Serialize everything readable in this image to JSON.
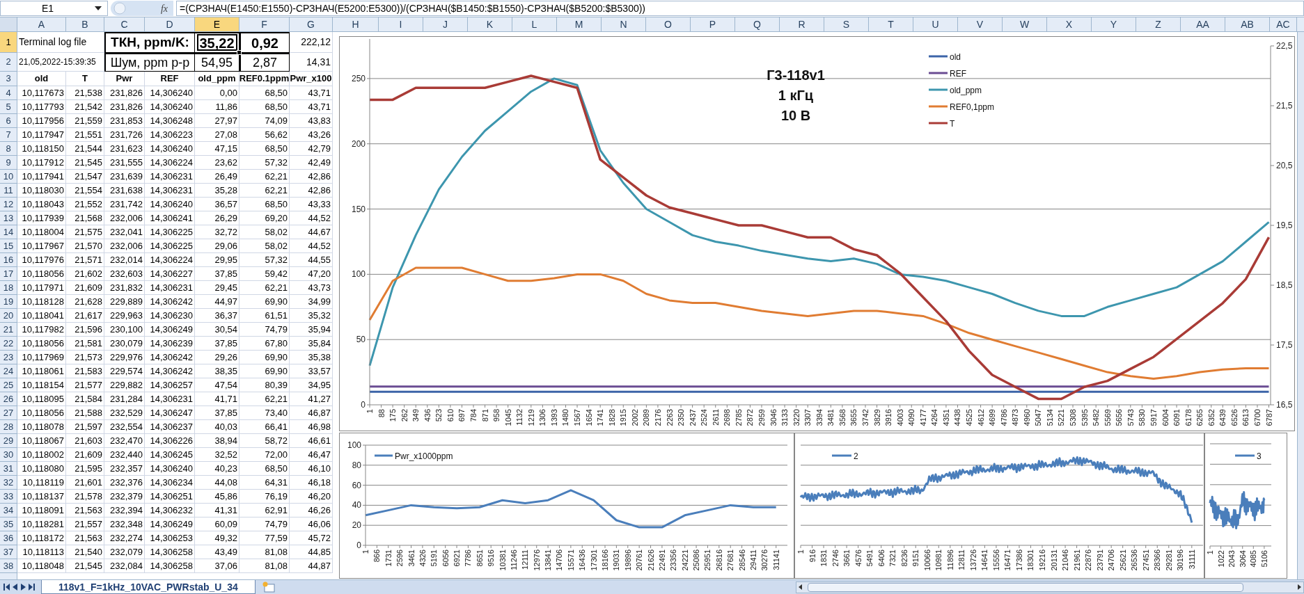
{
  "formula_bar": {
    "name_box": "E1",
    "function_label": "fx",
    "formula": "=(СРЗНАЧ(E1450:E1550)-СРЗНАЧ(E5200:E5300))/(СРЗНАЧ($B1450:$B1550)-СРЗНАЧ($B5200:$B5300))"
  },
  "columns": [
    {
      "label": "A",
      "selected": false
    },
    {
      "label": "B",
      "selected": false
    },
    {
      "label": "C",
      "selected": false
    },
    {
      "label": "D",
      "selected": false
    },
    {
      "label": "E",
      "selected": true
    },
    {
      "label": "F",
      "selected": false
    },
    {
      "label": "G",
      "selected": false
    },
    {
      "label": "H",
      "selected": false
    },
    {
      "label": "I",
      "selected": false
    },
    {
      "label": "J",
      "selected": false
    },
    {
      "label": "K",
      "selected": false
    },
    {
      "label": "L",
      "selected": false
    },
    {
      "label": "M",
      "selected": false
    },
    {
      "label": "N",
      "selected": false
    },
    {
      "label": "O",
      "selected": false
    },
    {
      "label": "P",
      "selected": false
    },
    {
      "label": "Q",
      "selected": false
    },
    {
      "label": "R",
      "selected": false
    },
    {
      "label": "S",
      "selected": false
    },
    {
      "label": "T",
      "selected": false
    },
    {
      "label": "U",
      "selected": false
    },
    {
      "label": "V",
      "selected": false
    },
    {
      "label": "W",
      "selected": false
    },
    {
      "label": "X",
      "selected": false
    },
    {
      "label": "Y",
      "selected": false
    },
    {
      "label": "Z",
      "selected": false
    },
    {
      "label": "AA",
      "selected": false
    },
    {
      "label": "AB",
      "selected": false
    },
    {
      "label": "AC",
      "selected": false
    }
  ],
  "rows": [
    {
      "num": "1",
      "kind": "title",
      "selected": true,
      "cells": [
        "Terminal log file",
        "ТКН, ppm/K:",
        "35,22",
        "0,92",
        "222,12"
      ]
    },
    {
      "num": "2",
      "kind": "summary",
      "selected": false,
      "cells": [
        "21,05,2022-15:39:35",
        "Шум, ppm p-p",
        "54,95",
        "2,87",
        "14,31"
      ]
    },
    {
      "num": "3",
      "kind": "header",
      "selected": false,
      "cells": [
        "old",
        "T",
        "Pwr",
        "REF",
        "old_ppm",
        "REF0.1ppm",
        "Pwr_x100"
      ]
    },
    {
      "num": "4",
      "kind": "data",
      "selected": false,
      "cells": [
        "10,117673",
        "21,538",
        "231,826",
        "14,306240",
        "0,00",
        "68,50",
        "43,71"
      ]
    },
    {
      "num": "5",
      "kind": "data",
      "selected": false,
      "cells": [
        "10,117793",
        "21,542",
        "231,826",
        "14,306240",
        "11,86",
        "68,50",
        "43,71"
      ]
    },
    {
      "num": "6",
      "kind": "data",
      "selected": false,
      "cells": [
        "10,117956",
        "21,559",
        "231,853",
        "14,306248",
        "27,97",
        "74,09",
        "43,83"
      ]
    },
    {
      "num": "7",
      "kind": "data",
      "selected": false,
      "cells": [
        "10,117947",
        "21,551",
        "231,726",
        "14,306223",
        "27,08",
        "56,62",
        "43,26"
      ]
    },
    {
      "num": "8",
      "kind": "data",
      "selected": false,
      "cells": [
        "10,118150",
        "21,544",
        "231,623",
        "14,306240",
        "47,15",
        "68,50",
        "42,79"
      ]
    },
    {
      "num": "9",
      "kind": "data",
      "selected": false,
      "cells": [
        "10,117912",
        "21,545",
        "231,555",
        "14,306224",
        "23,62",
        "57,32",
        "42,49"
      ]
    },
    {
      "num": "10",
      "kind": "data",
      "selected": false,
      "cells": [
        "10,117941",
        "21,547",
        "231,639",
        "14,306231",
        "26,49",
        "62,21",
        "42,86"
      ]
    },
    {
      "num": "11",
      "kind": "data",
      "selected": false,
      "cells": [
        "10,118030",
        "21,554",
        "231,638",
        "14,306231",
        "35,28",
        "62,21",
        "42,86"
      ]
    },
    {
      "num": "12",
      "kind": "data",
      "selected": false,
      "cells": [
        "10,118043",
        "21,552",
        "231,742",
        "14,306240",
        "36,57",
        "68,50",
        "43,33"
      ]
    },
    {
      "num": "13",
      "kind": "data",
      "selected": false,
      "cells": [
        "10,117939",
        "21,568",
        "232,006",
        "14,306241",
        "26,29",
        "69,20",
        "44,52"
      ]
    },
    {
      "num": "14",
      "kind": "data",
      "selected": false,
      "cells": [
        "10,118004",
        "21,575",
        "232,041",
        "14,306225",
        "32,72",
        "58,02",
        "44,67"
      ]
    },
    {
      "num": "15",
      "kind": "data",
      "selected": false,
      "cells": [
        "10,117967",
        "21,570",
        "232,006",
        "14,306225",
        "29,06",
        "58,02",
        "44,52"
      ]
    },
    {
      "num": "16",
      "kind": "data",
      "selected": false,
      "cells": [
        "10,117976",
        "21,571",
        "232,014",
        "14,306224",
        "29,95",
        "57,32",
        "44,55"
      ]
    },
    {
      "num": "17",
      "kind": "data",
      "selected": false,
      "cells": [
        "10,118056",
        "21,602",
        "232,603",
        "14,306227",
        "37,85",
        "59,42",
        "47,20"
      ]
    },
    {
      "num": "18",
      "kind": "data",
      "selected": false,
      "cells": [
        "10,117971",
        "21,609",
        "231,832",
        "14,306231",
        "29,45",
        "62,21",
        "43,73"
      ]
    },
    {
      "num": "19",
      "kind": "data",
      "selected": false,
      "cells": [
        "10,118128",
        "21,628",
        "229,889",
        "14,306242",
        "44,97",
        "69,90",
        "34,99"
      ]
    },
    {
      "num": "20",
      "kind": "data",
      "selected": false,
      "cells": [
        "10,118041",
        "21,617",
        "229,963",
        "14,306230",
        "36,37",
        "61,51",
        "35,32"
      ]
    },
    {
      "num": "21",
      "kind": "data",
      "selected": false,
      "cells": [
        "10,117982",
        "21,596",
        "230,100",
        "14,306249",
        "30,54",
        "74,79",
        "35,94"
      ]
    },
    {
      "num": "22",
      "kind": "data",
      "selected": false,
      "cells": [
        "10,118056",
        "21,581",
        "230,079",
        "14,306239",
        "37,85",
        "67,80",
        "35,84"
      ]
    },
    {
      "num": "23",
      "kind": "data",
      "selected": false,
      "cells": [
        "10,117969",
        "21,573",
        "229,976",
        "14,306242",
        "29,26",
        "69,90",
        "35,38"
      ]
    },
    {
      "num": "24",
      "kind": "data",
      "selected": false,
      "cells": [
        "10,118061",
        "21,583",
        "229,574",
        "14,306242",
        "38,35",
        "69,90",
        "33,57"
      ]
    },
    {
      "num": "25",
      "kind": "data",
      "selected": false,
      "cells": [
        "10,118154",
        "21,577",
        "229,882",
        "14,306257",
        "47,54",
        "80,39",
        "34,95"
      ]
    },
    {
      "num": "26",
      "kind": "data",
      "selected": false,
      "cells": [
        "10,118095",
        "21,584",
        "231,284",
        "14,306231",
        "41,71",
        "62,21",
        "41,27"
      ]
    },
    {
      "num": "27",
      "kind": "data",
      "selected": false,
      "cells": [
        "10,118056",
        "21,588",
        "232,529",
        "14,306247",
        "37,85",
        "73,40",
        "46,87"
      ]
    },
    {
      "num": "28",
      "kind": "data",
      "selected": false,
      "cells": [
        "10,118078",
        "21,597",
        "232,554",
        "14,306237",
        "40,03",
        "66,41",
        "46,98"
      ]
    },
    {
      "num": "29",
      "kind": "data",
      "selected": false,
      "cells": [
        "10,118067",
        "21,603",
        "232,470",
        "14,306226",
        "38,94",
        "58,72",
        "46,61"
      ]
    },
    {
      "num": "30",
      "kind": "data",
      "selected": false,
      "cells": [
        "10,118002",
        "21,609",
        "232,440",
        "14,306245",
        "32,52",
        "72,00",
        "46,47"
      ]
    },
    {
      "num": "31",
      "kind": "data",
      "selected": false,
      "cells": [
        "10,118080",
        "21,595",
        "232,357",
        "14,306240",
        "40,23",
        "68,50",
        "46,10"
      ]
    },
    {
      "num": "32",
      "kind": "data",
      "selected": false,
      "cells": [
        "10,118119",
        "21,601",
        "232,376",
        "14,306234",
        "44,08",
        "64,31",
        "46,18"
      ]
    },
    {
      "num": "33",
      "kind": "data",
      "selected": false,
      "cells": [
        "10,118137",
        "21,578",
        "232,379",
        "14,306251",
        "45,86",
        "76,19",
        "46,20"
      ]
    },
    {
      "num": "34",
      "kind": "data",
      "selected": false,
      "cells": [
        "10,118091",
        "21,563",
        "232,394",
        "14,306232",
        "41,31",
        "62,91",
        "46,26"
      ]
    },
    {
      "num": "35",
      "kind": "data",
      "selected": false,
      "cells": [
        "10,118281",
        "21,557",
        "232,348",
        "14,306249",
        "60,09",
        "74,79",
        "46,06"
      ]
    },
    {
      "num": "36",
      "kind": "data",
      "selected": false,
      "cells": [
        "10,118172",
        "21,563",
        "232,274",
        "14,306253",
        "49,32",
        "77,59",
        "45,72"
      ]
    },
    {
      "num": "37",
      "kind": "data",
      "selected": false,
      "cells": [
        "10,118113",
        "21,540",
        "232,079",
        "14,306258",
        "43,49",
        "81,08",
        "44,85"
      ]
    },
    {
      "num": "38",
      "kind": "data",
      "selected": false,
      "cells": [
        "10,118048",
        "21,545",
        "232,084",
        "14,306258",
        "37,06",
        "81,08",
        "44,87"
      ]
    }
  ],
  "main_chart": {
    "caption": [
      "Г3-118v1",
      "1 кГц",
      "10 В"
    ],
    "chart_data": {
      "type": "line",
      "grid": true,
      "legend": "top-right",
      "x": [
        1,
        175,
        349,
        523,
        697,
        871,
        1045,
        1219,
        1393,
        1567,
        1741,
        1915,
        2089,
        2263,
        2437,
        2611,
        2785,
        2959,
        3133,
        3307,
        3481,
        3655,
        3829,
        4003,
        4177,
        4351,
        4525,
        4699,
        4873,
        5047,
        5221,
        5395,
        5569,
        5743,
        5917,
        6091,
        6265,
        6439,
        6613,
        6787
      ],
      "xlim": [
        1,
        6800
      ],
      "ylim": [
        0,
        275
      ],
      "yticks": [
        0,
        50,
        100,
        150,
        200,
        250
      ],
      "y2lim": [
        16.5,
        22.5
      ],
      "y2ticks": [
        {
          "value": 16.5,
          "label": "16,5"
        },
        {
          "value": 17.5,
          "label": "17,5"
        },
        {
          "value": 18.5,
          "label": "18,5"
        },
        {
          "value": 19.5,
          "label": "19,5"
        },
        {
          "value": 20.5,
          "label": "20,5"
        },
        {
          "value": 21.5,
          "label": "21,5"
        },
        {
          "value": 22.5,
          "label": "22,5"
        }
      ],
      "xticks": [
        1,
        88,
        175,
        262,
        349,
        436,
        523,
        610,
        697,
        784,
        871,
        958,
        1045,
        1132,
        1219,
        1306,
        1393,
        1480,
        1567,
        1654,
        1741,
        1828,
        1915,
        2002,
        2089,
        2176,
        2263,
        2350,
        2437,
        2524,
        2611,
        2698,
        2785,
        2872,
        2959,
        3046,
        3133,
        3220,
        3307,
        3394,
        3481,
        3568,
        3655,
        3742,
        3829,
        3916,
        4003,
        4090,
        4177,
        4264,
        4351,
        4438,
        4525,
        4612,
        4699,
        4786,
        4873,
        4960,
        5047,
        5134,
        5221,
        5308,
        5395,
        5482,
        5569,
        5656,
        5743,
        5830,
        5917,
        6004,
        6091,
        6178,
        6265,
        6352,
        6439,
        6526,
        6613,
        6700,
        6787
      ],
      "series": [
        {
          "name": "old",
          "color": "#3c64a8",
          "values": [
            10,
            10,
            10,
            10,
            10,
            10,
            10,
            10,
            10,
            10,
            10,
            10,
            10,
            10,
            10,
            10,
            10,
            10,
            10,
            10,
            10,
            10,
            10,
            10,
            10,
            10,
            10,
            10,
            10,
            10,
            10,
            10,
            10,
            10,
            10,
            10,
            10,
            10,
            10,
            10
          ]
        },
        {
          "name": "REF",
          "color": "#6a4c93",
          "values": [
            14,
            14,
            14,
            14,
            14,
            14,
            14,
            14,
            14,
            14,
            14,
            14,
            14,
            14,
            14,
            14,
            14,
            14,
            14,
            14,
            14,
            14,
            14,
            14,
            14,
            14,
            14,
            14,
            14,
            14,
            14,
            14,
            14,
            14,
            14,
            14,
            14,
            14,
            14,
            14
          ]
        },
        {
          "name": "old_ppm",
          "color": "#3d96ae",
          "values": [
            30,
            90,
            130,
            165,
            190,
            210,
            225,
            240,
            250,
            245,
            195,
            170,
            150,
            140,
            130,
            125,
            122,
            118,
            115,
            112,
            110,
            112,
            108,
            100,
            98,
            95,
            90,
            85,
            78,
            72,
            68,
            68,
            75,
            80,
            85,
            90,
            100,
            110,
            125,
            140
          ]
        },
        {
          "name": "REF0,1ppm",
          "color": "#e07c32",
          "values": [
            65,
            95,
            105,
            105,
            105,
            100,
            95,
            95,
            97,
            100,
            100,
            95,
            85,
            80,
            78,
            78,
            75,
            72,
            70,
            68,
            70,
            72,
            72,
            70,
            68,
            62,
            55,
            50,
            45,
            40,
            35,
            30,
            25,
            22,
            20,
            22,
            25,
            27,
            28,
            28
          ]
        },
        {
          "name": "T",
          "color": "#a93b36",
          "axis": "y2",
          "values": [
            21.6,
            21.6,
            21.8,
            21.8,
            21.8,
            21.8,
            21.9,
            22.0,
            21.9,
            21.8,
            20.6,
            20.3,
            20.0,
            19.8,
            19.7,
            19.6,
            19.5,
            19.5,
            19.4,
            19.3,
            19.3,
            19.1,
            19.0,
            18.7,
            18.3,
            17.9,
            17.4,
            17.0,
            16.8,
            16.6,
            16.6,
            16.8,
            16.9,
            17.1,
            17.3,
            17.6,
            17.9,
            18.2,
            18.6,
            19.3
          ]
        }
      ]
    }
  },
  "power_chart": {
    "chart_data": {
      "type": "line",
      "grid": true,
      "legend": "top-left",
      "x": [
        1,
        1731,
        3461,
        5191,
        6921,
        8651,
        10381,
        12111,
        13841,
        15571,
        17301,
        19031,
        20761,
        22491,
        24221,
        25951,
        27681,
        29411,
        31141
      ],
      "xlim": [
        1,
        32000
      ],
      "ylim": [
        0,
        100
      ],
      "yticks": [
        0,
        20,
        40,
        60,
        80,
        100
      ],
      "xticks": [
        1,
        866,
        1731,
        2596,
        3461,
        4326,
        5191,
        6056,
        6921,
        7786,
        8651,
        9516,
        10381,
        11246,
        12111,
        12976,
        13841,
        14706,
        15571,
        16436,
        17301,
        18166,
        19031,
        19896,
        20761,
        21626,
        22491,
        23356,
        24221,
        25086,
        25951,
        26816,
        27681,
        28546,
        29411,
        30276,
        31141
      ],
      "series": [
        {
          "name": "Pwr_x1000ppm",
          "color": "#4a7ebb",
          "values": [
            30,
            35,
            40,
            38,
            37,
            38,
            45,
            42,
            45,
            55,
            45,
            25,
            18,
            18,
            30,
            35,
            40,
            38,
            38
          ]
        }
      ]
    }
  },
  "chart_2": {
    "legend": "2",
    "axis_labels": [
      "1",
      "916",
      "1831",
      "2746",
      "3661",
      "4576",
      "5491",
      "6406",
      "7321",
      "8236",
      "9151",
      "10066",
      "10981",
      "11896",
      "12811",
      "13726",
      "14641",
      "15556",
      "16471",
      "17386",
      "18301",
      "19216",
      "20131",
      "21046",
      "21961",
      "22876",
      "23791",
      "24706",
      "25621",
      "26536",
      "27451",
      "28366",
      "29281",
      "30196",
      "31111"
    ]
  },
  "chart_3": {
    "legend": "3",
    "axis_labels": [
      "1",
      "1022",
      "2043",
      "3064",
      "4085",
      "5106"
    ]
  },
  "sheet_tabs": [
    {
      "label": "118v1_F=1kHz_10VAC_PWRstab_U_34",
      "selected": true
    }
  ]
}
